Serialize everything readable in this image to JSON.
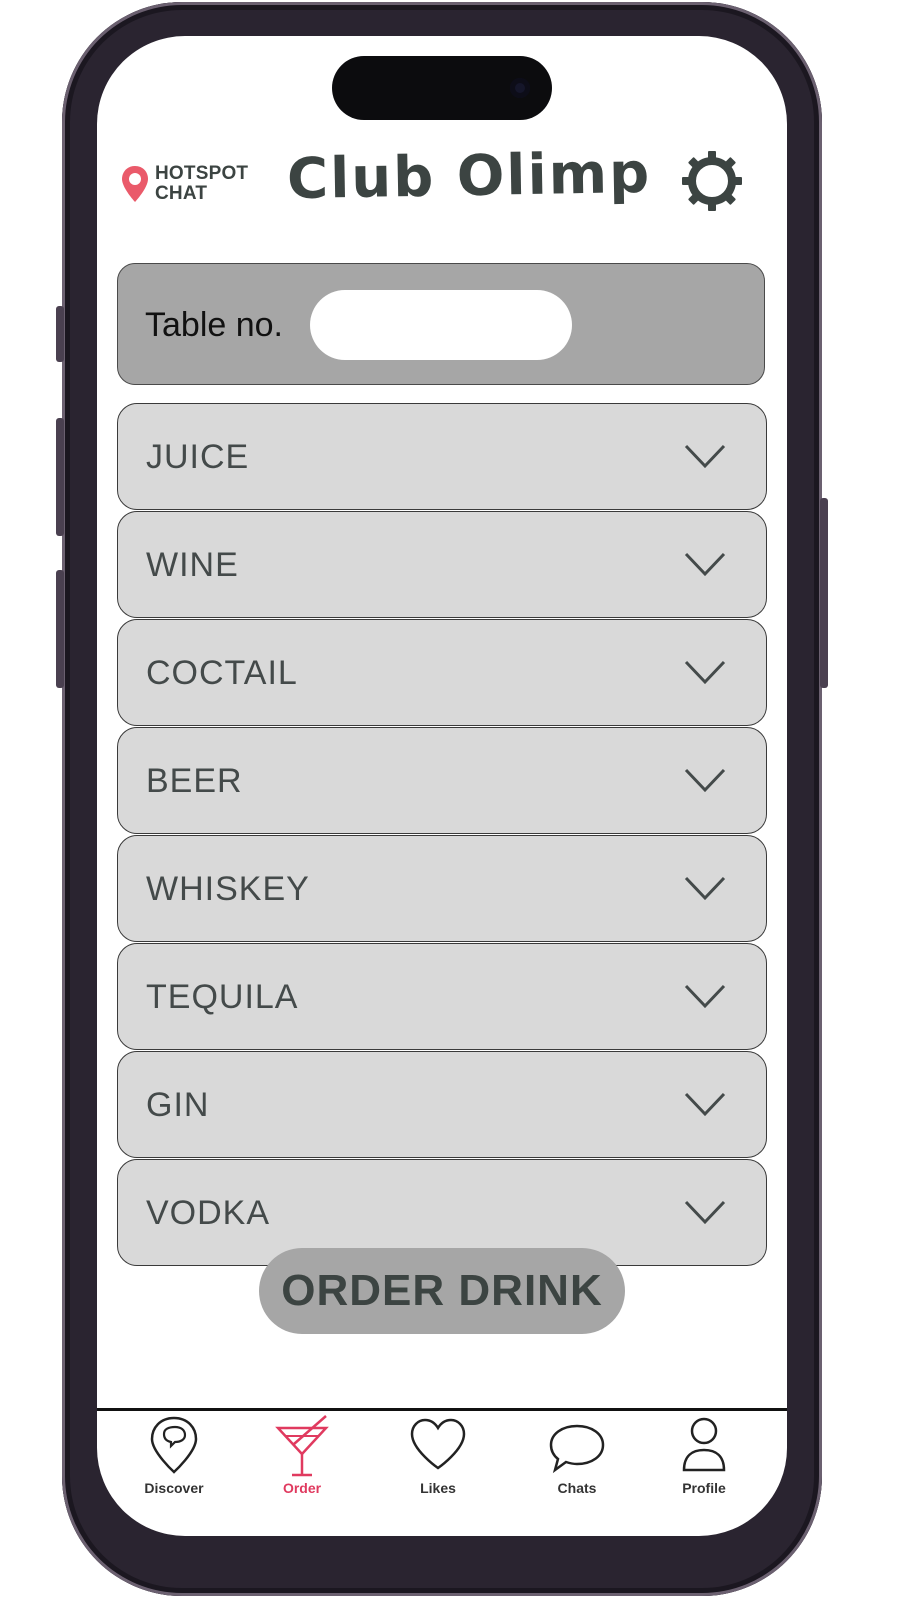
{
  "header": {
    "logo_line1": "HOTSPOT",
    "logo_line2": "CHAT",
    "title": "Club Olimp",
    "settings_icon": "gear-icon"
  },
  "table": {
    "label": "Table no.",
    "value": ""
  },
  "categories": [
    {
      "label": "JUICE"
    },
    {
      "label": "WINE"
    },
    {
      "label": "COCTAIL"
    },
    {
      "label": "BEER"
    },
    {
      "label": "WHISKEY"
    },
    {
      "label": "TEQUILA"
    },
    {
      "label": "GIN"
    },
    {
      "label": "VODKA"
    }
  ],
  "order_button": "ORDER DRINK",
  "nav": {
    "items": [
      {
        "label": "Discover",
        "icon": "chat-pin-icon"
      },
      {
        "label": "Order",
        "icon": "cocktail-icon",
        "active": true
      },
      {
        "label": "Likes",
        "icon": "heart-icon"
      },
      {
        "label": "Chats",
        "icon": "speech-bubble-icon"
      },
      {
        "label": "Profile",
        "icon": "person-icon"
      }
    ]
  },
  "colors": {
    "accent": "#e03a5f",
    "text_dark": "#3c4442",
    "panel_gray": "#a6a6a6",
    "item_gray": "#d9d9d9"
  }
}
